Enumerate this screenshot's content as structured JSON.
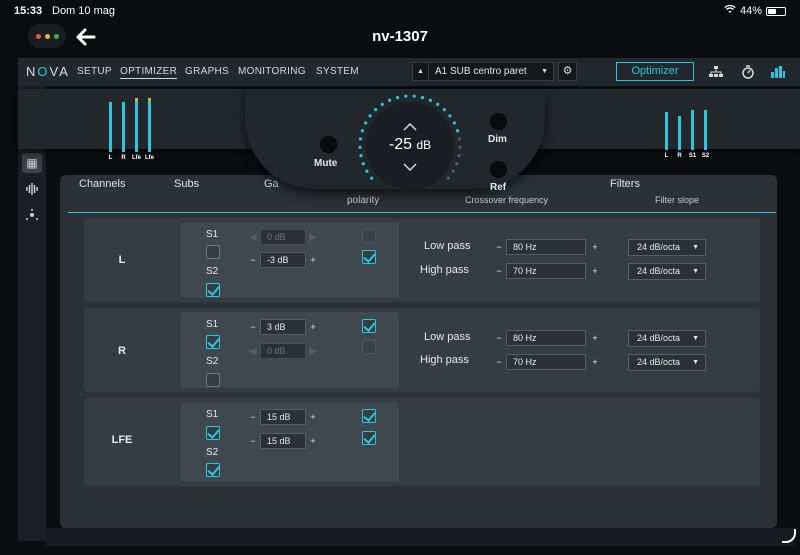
{
  "status": {
    "time": "15:33",
    "date": "Dom 10 mag",
    "battery": "44%"
  },
  "header": {
    "title": "nv-1307"
  },
  "nav": {
    "logo_a": "N",
    "logo_b": "O",
    "logo_c": "VA",
    "items": [
      {
        "label": "SETUP"
      },
      {
        "label": "OPTIMIZER"
      },
      {
        "label": "GRAPHS"
      },
      {
        "label": "MONITORING"
      },
      {
        "label": "SYSTEM"
      }
    ],
    "preset": "A1 SUB centro paret",
    "optimizer_button": "Optimizer"
  },
  "overlay": {
    "left_meters": [
      "L",
      "R",
      "Lfe",
      "Lfe"
    ],
    "right_meters": [
      "L",
      "R",
      "S1",
      "S2"
    ],
    "mute": "Mute",
    "volume_value": "-25",
    "volume_unit": "dB",
    "dim": "Dim",
    "ref": "Ref"
  },
  "table": {
    "headers": {
      "channels": "Channels",
      "subs": "Subs",
      "gain": "Ga",
      "filters": "Filters"
    },
    "subheaders": {
      "polarity": "polarity",
      "crossover": "Crossover frequency",
      "slope": "Filter slope"
    },
    "rows": [
      {
        "name": "L",
        "s1_label": "S1",
        "s2_label": "S2",
        "s1_checked": false,
        "s2_checked": true,
        "gain1": "0 dB",
        "gain2": "-3 dB",
        "pol1": false,
        "pol2": true,
        "low_pass_label": "Low pass",
        "low_pass": "80 Hz",
        "low_slope": "24 dB/octa",
        "high_pass_label": "High pass",
        "high_pass": "70 Hz",
        "high_slope": "24 dB/octa"
      },
      {
        "name": "R",
        "s1_label": "S1",
        "s2_label": "S2",
        "s1_checked": true,
        "s2_checked": false,
        "gain1": "3 dB",
        "gain2": "0 dB",
        "pol1": true,
        "pol2": false,
        "low_pass_label": "Low pass",
        "low_pass": "80 Hz",
        "low_slope": "24 dB/octa",
        "high_pass_label": "High pass",
        "high_pass": "70 Hz",
        "high_slope": "24 dB/octa"
      },
      {
        "name": "LFE",
        "s1_label": "S1",
        "s2_label": "S2",
        "s1_checked": true,
        "s2_checked": true,
        "gain1": "15 dB",
        "gain2": "15 dB",
        "pol1": true,
        "pol2": true
      }
    ]
  },
  "colors": {
    "accent": "#2ec6dc",
    "meter_peak": "#e8a43a",
    "background": "#0b0d10",
    "panel": "#2b3137"
  }
}
